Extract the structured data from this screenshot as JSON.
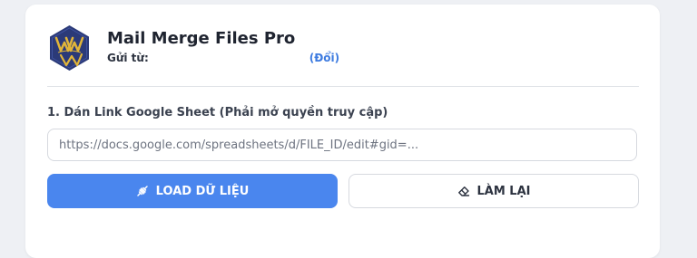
{
  "app": {
    "title": "Mail Merge Files Pro",
    "sender_label": "Gửi từ:",
    "sender_value": "",
    "change_link": "(Đổi)"
  },
  "sheet": {
    "label": "1. Dán Link Google Sheet (Phải mở quyền truy cập)",
    "placeholder": "https://docs.google.com/spreadsheets/d/FILE_ID/edit#gid=...",
    "value": ""
  },
  "actions": {
    "load_label": "LOAD DỮ LIỆU",
    "load_icon": "plug-icon",
    "reset_label": "LÀM LẠI",
    "reset_icon": "eraser-icon"
  },
  "colors": {
    "accent": "#4a86ee",
    "link": "#3d7be0",
    "logo_bg": "#2b3a78",
    "logo_gold": "#e0b53a"
  }
}
